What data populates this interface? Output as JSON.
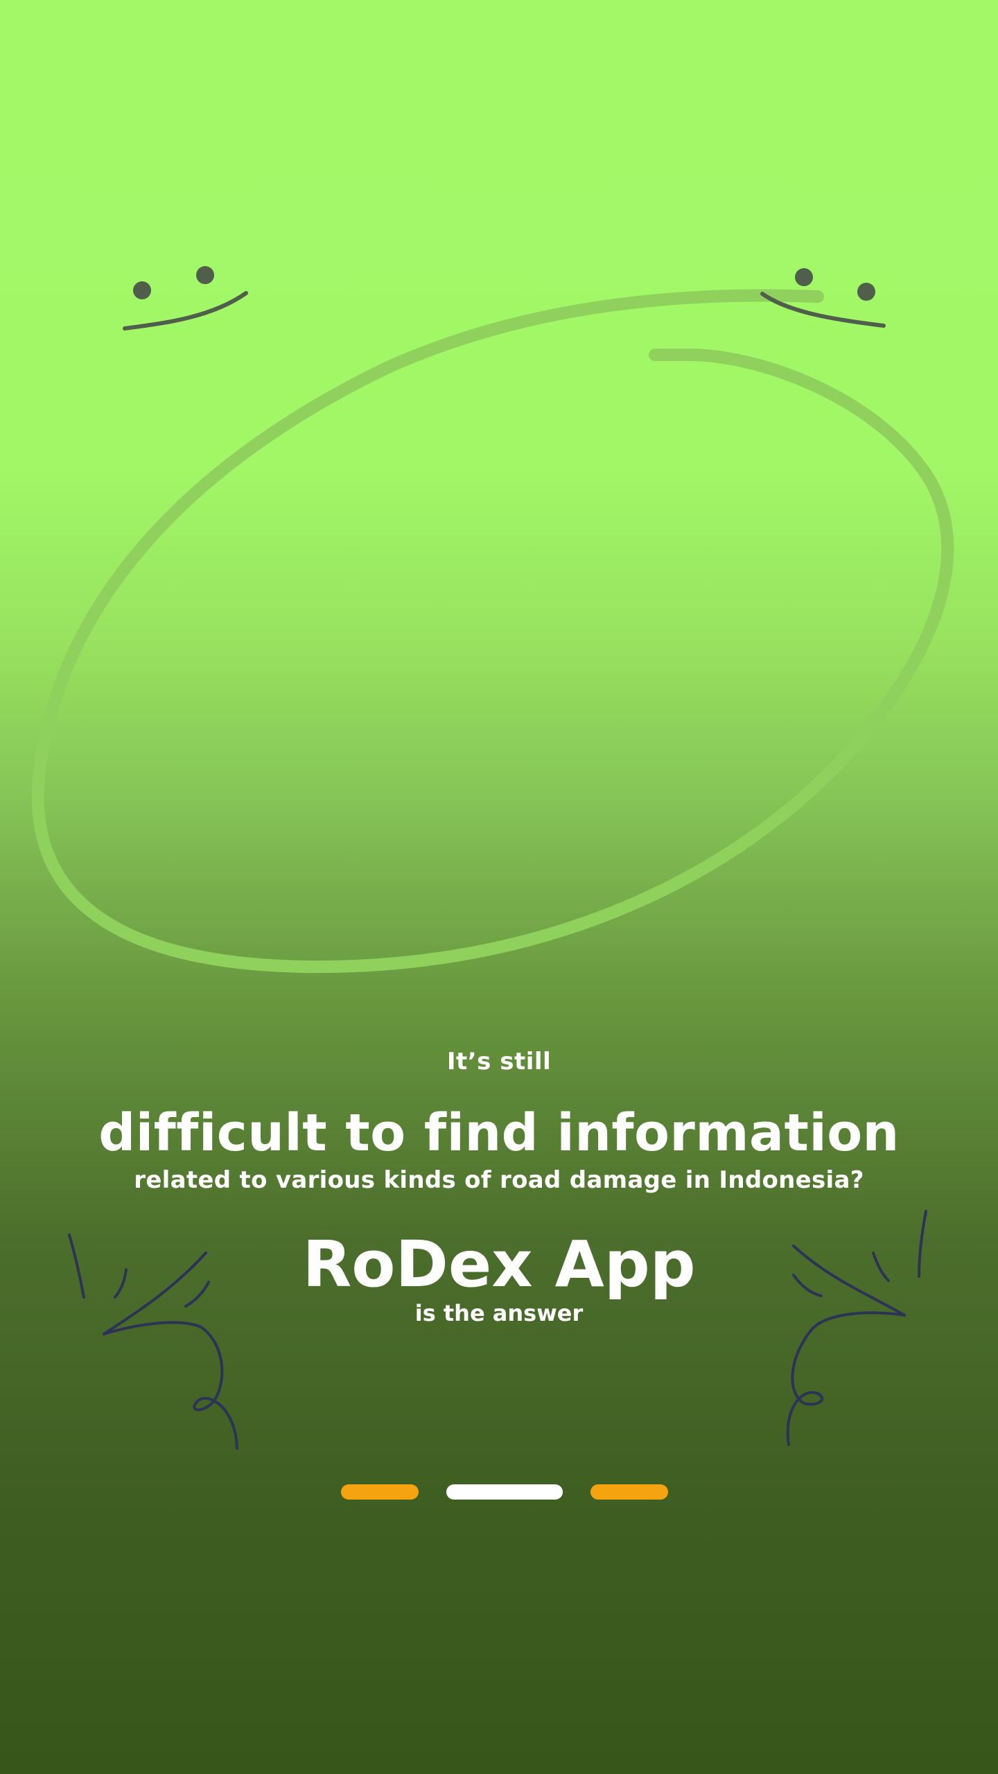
{
  "onboarding": {
    "line_small": "It’s still",
    "line_big": "difficult to find information",
    "line_medium": "related to various kinds of road damage in Indonesia?",
    "app_name": "RoDex App",
    "line_answer": "is the answer"
  },
  "pager": {
    "total_pages": 3,
    "active_page": 2,
    "inactive_color": "#f5a30f",
    "active_color": "#ffffff"
  },
  "colors": {
    "background_top": "#a3f868",
    "background_bottom": "#36561a",
    "text": "#ffffff",
    "doodle_face": "#4f5f4b",
    "doodle_sparkle": "#2c3354"
  },
  "decorations": {
    "icons": [
      "smiley-face-icon",
      "oval-doodle-icon",
      "sparkle-doodle-icon"
    ]
  }
}
